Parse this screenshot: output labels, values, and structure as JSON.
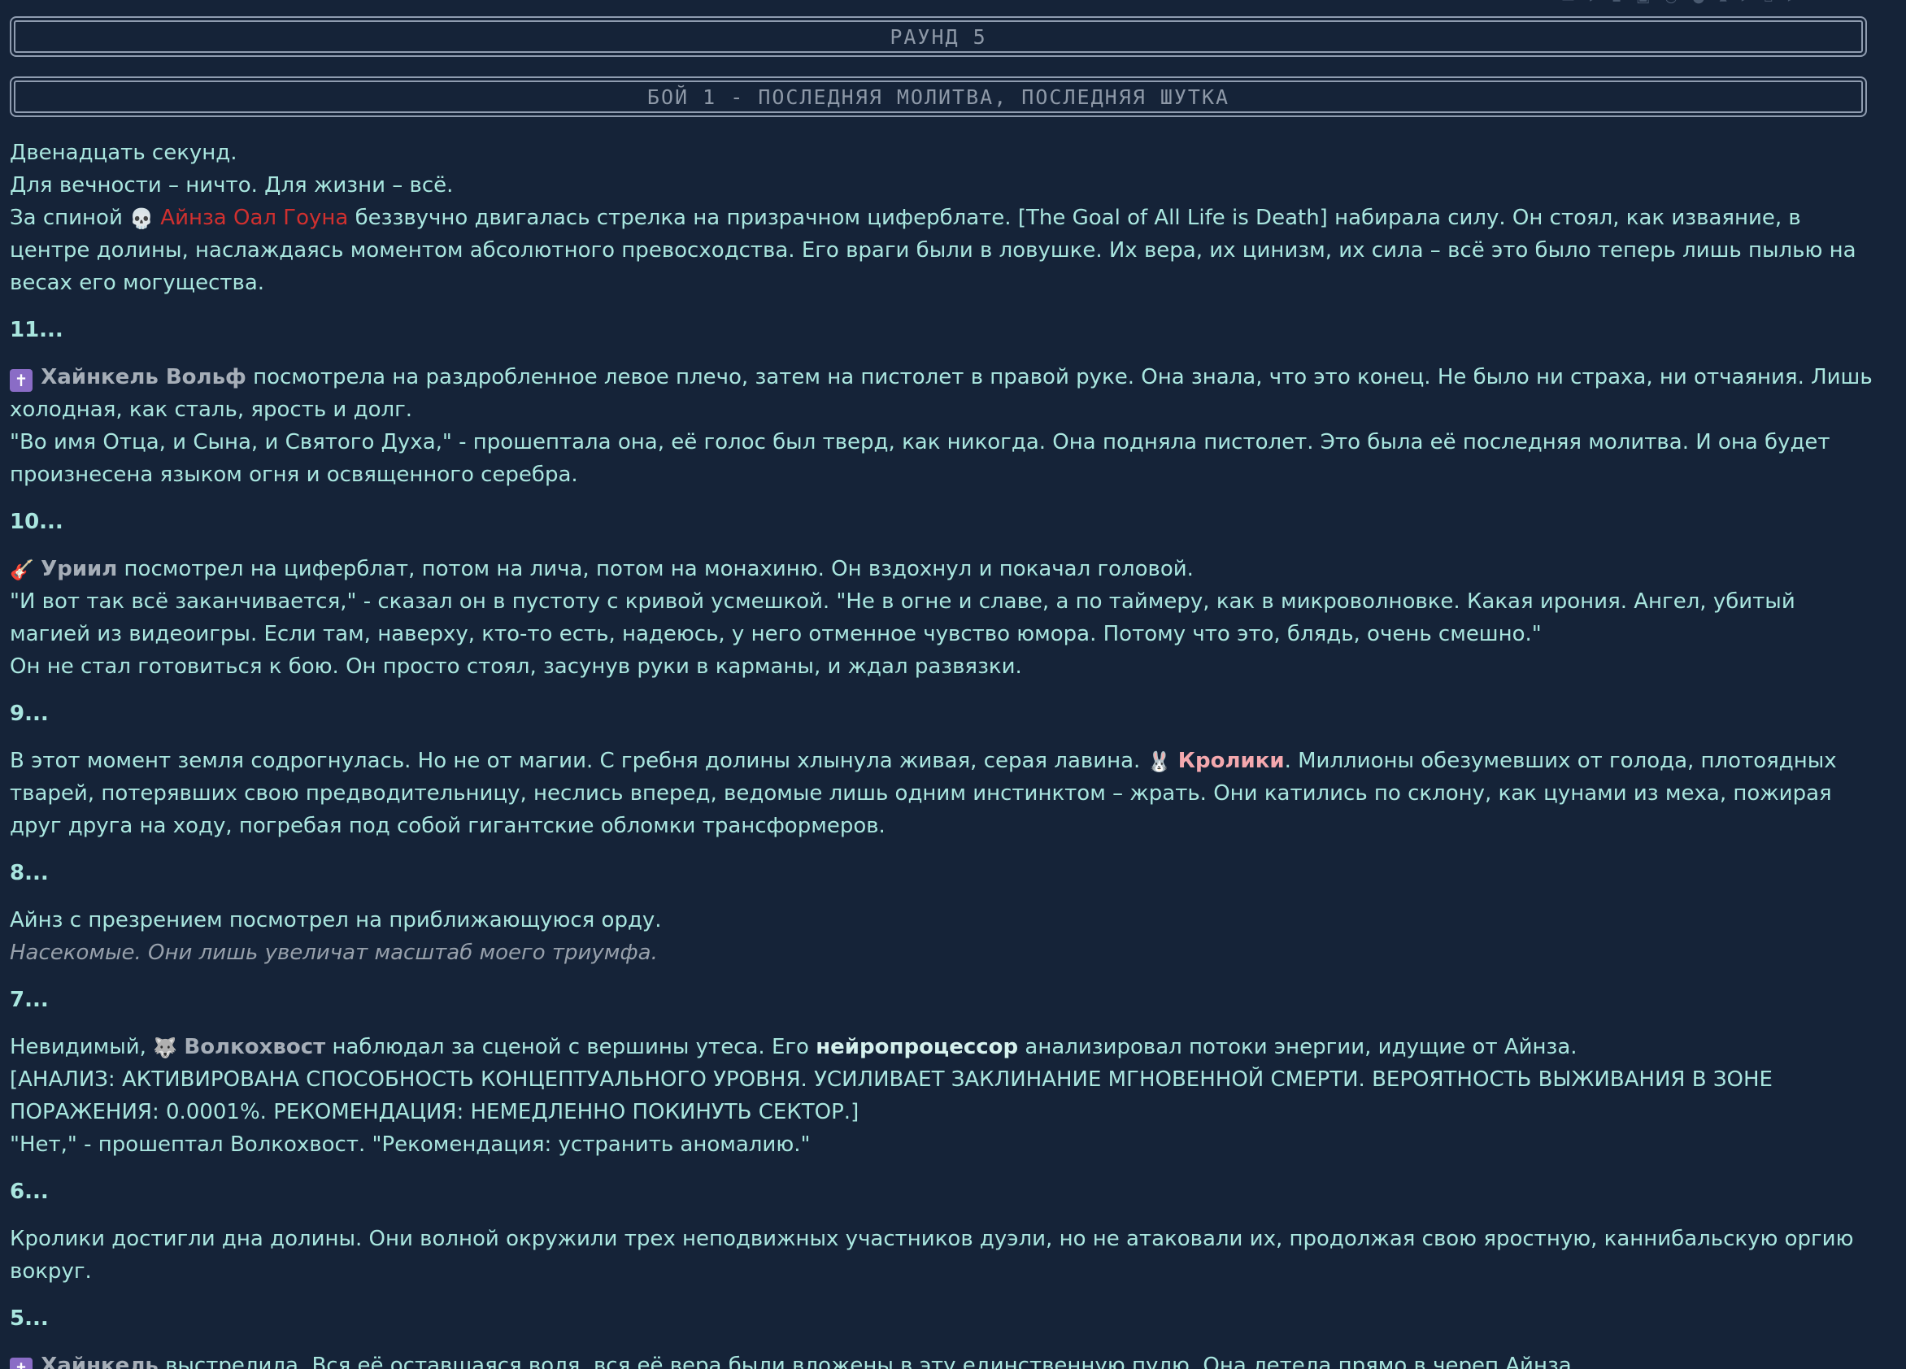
{
  "header": {
    "round_label": "РАУНД 5",
    "fight_label": "БОЙ 1 - ПОСЛЕДНЯЯ МОЛИТВА, ПОСЛЕДНЯЯ ШУТКА"
  },
  "story": {
    "b1_l1": "Двенадцать секунд.",
    "b1_l2": "Для вечности – ничто. Для жизни – всё.",
    "b1_l3_pre": "За спиной ",
    "b1_name": "Айнза Оал Гоуна",
    "b1_l3_post": " беззвучно двигалась стрелка на призрачном циферблате. [The Goal of All Life is Death] набирала силу. Он стоял, как изваяние, в центре долины, наслаждаясь моментом абсолютного превосходства. Его враги были в ловушке. Их вера, их цинизм, их сила – всё это было теперь лишь пылью на весах его могущества.",
    "c11": "11...",
    "b2_name": "Хайнкель Вольф",
    "b2_l1_post": " посмотрела на раздробленное левое плечо, затем на пистолет в правой руке. Она знала, что это конец. Не было ни страха, ни отчаяния. Лишь холодная, как сталь, ярость и долг.",
    "b2_l2": "\"Во имя Отца, и Сына, и Святого Духа,\" - прошептала она, её голос был тверд, как никогда. Она подняла пистолет. Это была её последняя молитва. И она будет произнесена языком огня и освященного серебра.",
    "c10": "10...",
    "b3_name": "Уриил",
    "b3_l1_post": " посмотрел на циферблат, потом на лича, потом на монахиню. Он вздохнул и покачал головой.",
    "b3_l2": "\"И вот так всё заканчивается,\" - сказал он в пустоту с кривой усмешкой. \"Не в огне и славе, а по таймеру, как в микроволновке. Какая ирония. Ангел, убитый магией из видеоигры. Если там, наверху, кто-то есть, надеюсь, у него отменное чувство юмора. Потому что это, блядь, очень смешно.\"",
    "b3_l3": "Он не стал готовиться к бою. Он просто стоял, засунув руки в карманы, и ждал развязки.",
    "c9": "9...",
    "b4_pre": "В этот момент земля содрогнулась. Но не от магии. С гребня долины хлынула живая, серая лавина. ",
    "b4_name": "Кролики",
    "b4_post": ". Миллионы обезумевших от голода, плотоядных тварей, потерявших свою предводительницу, неслись вперед, ведомые лишь одним инстинктом – жрать. Они катились по склону, как цунами из меха, пожирая друг друга на ходу, погребая под собой гигантские обломки трансформеров.",
    "c8": "8...",
    "b5_l1": "Айнз с презрением посмотрел на приближающуюся орду.",
    "b5_thought": "Насекомые. Они лишь увеличат масштаб моего триумфа.",
    "c7": "7...",
    "b6_pre": "Невидимый, ",
    "b6_name": "Волкохвост",
    "b6_mid": " наблюдал за сценой с вершины утеса. Его ",
    "b6_bold": "нейропроцессор",
    "b6_post": " анализировал потоки энергии, идущие от Айнза.",
    "b6_l2": "[АНАЛИЗ: АКТИВИРОВАНА СПОСОБНОСТЬ КОНЦЕПТУАЛЬНОГО УРОВНЯ. УСИЛИВАЕТ ЗАКЛИНАНИЕ МГНОВЕННОЙ СМЕРТИ. ВЕРОЯТНОСТЬ ВЫЖИВАНИЯ В ЗОНЕ ПОРАЖЕНИЯ: 0.0001%. РЕКОМЕНДАЦИЯ: НЕМЕДЛЕННО ПОКИНУТЬ СЕКТОР.]",
    "b6_l3": "\"Нет,\" - прошептал Волкохвост. \"Рекомендация: устранить аномалию.\"",
    "c6": "6...",
    "b7": "Кролики достигли дна долины. Они волной окружили трех неподвижных участников дуэли, но не атаковали их, продолжая свою яростную, каннибальскую оргию вокруг.",
    "c5": "5...",
    "b8_name": "Хайнкель",
    "b8_post": " выстрелила. Вся её оставшаяся воля, вся её вера были вложены в эту единственную пулю. Она летела прямо в череп Айнза."
  },
  "icons": {
    "skull": "skull-icon",
    "cross": "latin-cross-icon",
    "guitar": "guitar-icon",
    "rabbit": "rabbit-icon",
    "wolf": "wolf-icon"
  },
  "colors": {
    "background": "#152338",
    "text": "#a9e6df",
    "ainz_name": "#d0302f",
    "rabbits_name": "#f4a8ae",
    "neutral_name": "#a6aeb8"
  }
}
